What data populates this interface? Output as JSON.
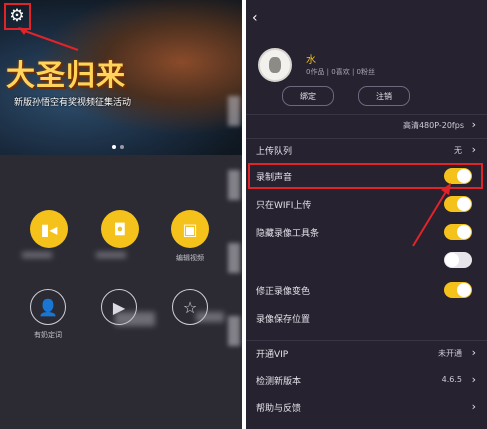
{
  "left": {
    "banner": {
      "title": "大圣归来",
      "subtitle": "新版孙悟空有奖视频征集活动"
    },
    "actions_row1": [
      {
        "icon": "video-camera-icon"
      },
      {
        "icon": "camera-icon"
      },
      {
        "icon": "image-edit-icon",
        "label": "编辑视频"
      }
    ],
    "actions_row2": [
      {
        "icon": "user-icon",
        "label": "有奶定词"
      },
      {
        "icon": "play-icon",
        "label": ""
      },
      {
        "icon": "star-icon",
        "label": ""
      }
    ]
  },
  "right": {
    "profile": {
      "name": "水",
      "stats": "0作品  |  0喜欢  |  0粉丝",
      "edit_label": "绑定",
      "logout_label": "注销"
    },
    "quality": "高清480P-20fps",
    "settings": [
      {
        "label": "上传队列",
        "value": "无",
        "control": "chevron"
      },
      {
        "label": "录制声音",
        "control": "toggle",
        "on": true,
        "highlighted": true
      },
      {
        "label": "只在WIFI上传",
        "control": "toggle",
        "on": true
      },
      {
        "label": "隐藏录像工具条",
        "control": "toggle",
        "on": true
      },
      {
        "label": "",
        "control": "toggle",
        "on": false
      },
      {
        "label": "修正录像变色",
        "control": "toggle",
        "on": true
      },
      {
        "label": "录像保存位置",
        "control": "none"
      },
      {
        "label": "开通VIP",
        "value": "未开通",
        "control": "chevron"
      },
      {
        "label": "检测新版本",
        "value": "4.6.5",
        "control": "chevron"
      },
      {
        "label": "帮助与反馈",
        "value": "",
        "control": "chevron"
      }
    ],
    "colors": {
      "accent": "#f4c21b",
      "highlight": "#e0242a"
    }
  }
}
